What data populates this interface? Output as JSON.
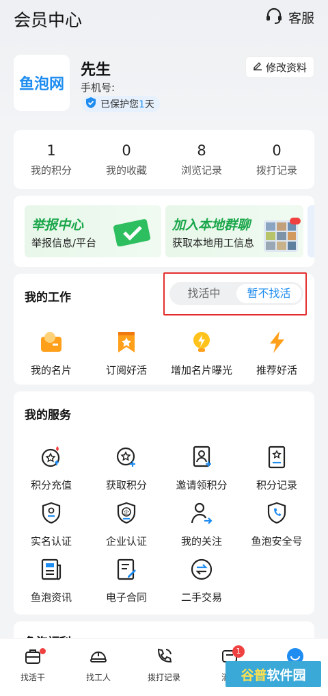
{
  "header": {
    "title": "会员中心",
    "service_label": "客服"
  },
  "profile": {
    "logo_text": "鱼泡网",
    "name": "先生",
    "phone_label": "手机号:",
    "protect_prefix": "已保护您",
    "protect_days": "1",
    "protect_suffix": "天",
    "edit_label": "修改资料"
  },
  "stats": [
    {
      "value": "1",
      "label": "我的积分"
    },
    {
      "value": "0",
      "label": "我的收藏"
    },
    {
      "value": "8",
      "label": "浏览记录"
    },
    {
      "value": "0",
      "label": "拨打记录"
    }
  ],
  "banners": [
    {
      "title": "举报中心",
      "subtitle": "举报信息/平台"
    },
    {
      "title": "加入本地群聊",
      "subtitle": "获取本地用工信息"
    }
  ],
  "work": {
    "title": "我的工作",
    "toggle": {
      "options": [
        "找活中",
        "暂不找活"
      ],
      "selected": "暂不找活"
    },
    "items": [
      {
        "label": "我的名片",
        "icon": "business-card-icon"
      },
      {
        "label": "订阅好活",
        "icon": "subscribe-bookmark-icon"
      },
      {
        "label": "增加名片曝光",
        "icon": "lightning-bulb-icon"
      },
      {
        "label": "推荐好活",
        "icon": "lightning-icon"
      }
    ]
  },
  "services": {
    "title": "我的服务",
    "items": [
      {
        "label": "积分充值",
        "icon": "points-recharge-icon"
      },
      {
        "label": "获取积分",
        "icon": "get-points-icon"
      },
      {
        "label": "邀请领积分",
        "icon": "invite-points-icon"
      },
      {
        "label": "积分记录",
        "icon": "points-record-icon"
      },
      {
        "label": "实名认证",
        "icon": "real-name-shield-icon"
      },
      {
        "label": "企业认证",
        "icon": "enterprise-shield-icon"
      },
      {
        "label": "我的关注",
        "icon": "follow-user-icon"
      },
      {
        "label": "鱼泡安全号",
        "icon": "secure-phone-icon"
      },
      {
        "label": "鱼泡资讯",
        "icon": "news-icon"
      },
      {
        "label": "电子合同",
        "icon": "contract-icon"
      },
      {
        "label": "二手交易",
        "icon": "trade-icon"
      }
    ]
  },
  "welfare": {
    "title": "鱼泡福利"
  },
  "tabbar": [
    {
      "label": "找活干",
      "icon": "briefcase-icon"
    },
    {
      "label": "找工人",
      "icon": "helmet-icon"
    },
    {
      "label": "拨打记录",
      "icon": "phone-call-icon"
    },
    {
      "label": "消息",
      "icon": "message-icon",
      "badge": "1"
    },
    {
      "label": "",
      "icon": "member-icon"
    }
  ],
  "watermark": {
    "text1": "谷普",
    "text2": "软件园"
  },
  "colors": {
    "accent": "#1e8cf0",
    "green": "#1aa64a",
    "red": "#f04141",
    "orange": "#ff9f1a"
  }
}
